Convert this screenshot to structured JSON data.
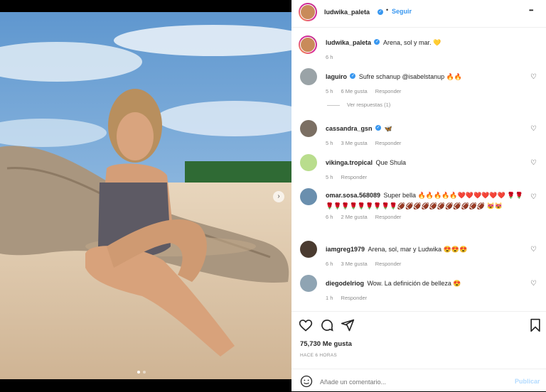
{
  "header": {
    "username": "ludwika_paleta",
    "follow_label": "Seguir",
    "more_label": "•••"
  },
  "caption": {
    "username": "ludwika_paleta",
    "text": "Arena, sol y mar. 💛",
    "time": "6 h"
  },
  "comments": [
    {
      "user": "laguiro",
      "verified": true,
      "text": "Sufre schanup @isabelstanup 🔥🔥",
      "time": "5 h",
      "likes": "6 Me gusta",
      "reply": "Responder",
      "view_replies": "Ver respuestas (1)"
    },
    {
      "user": "cassandra_gsn",
      "verified": true,
      "text": "🦋",
      "time": "5 h",
      "likes": "3 Me gusta",
      "reply": "Responder"
    },
    {
      "user": "vikinga.tropical",
      "verified": false,
      "text": "Que Shula",
      "time": "5 h",
      "likes": "",
      "reply": "Responder"
    },
    {
      "user": "omar.sosa.568089",
      "verified": false,
      "text": "Super bella 🔥🔥🔥🔥🔥❤️❤️❤️❤️❤️❤️ 🌹🌹🌹🌹🌹🌹🌹🌹🌹🌹🌹🏈🏈🏈🏈🏈🏈🏈🏈🏈🏈🏈 😻😻",
      "time": "6 h",
      "likes": "2 Me gusta",
      "reply": "Responder"
    },
    {
      "user": "iamgreg1979",
      "verified": false,
      "text": "Arena, sol, mar y Ludwika 😍😍😍",
      "time": "6 h",
      "likes": "3 Me gusta",
      "reply": "Responder"
    },
    {
      "user": "diegodelriog",
      "verified": false,
      "text": "Wow. La definición de belleza 😍",
      "time": "1 h",
      "likes": "",
      "reply": "Responder"
    }
  ],
  "post": {
    "likes": "75,730 Me gusta",
    "timestamp": "HACE 6 HORAS"
  },
  "add_comment": {
    "placeholder": "Añade un comentario...",
    "publish_label": "Publicar"
  },
  "colors": {
    "accent": "#3897f0",
    "text": "#262626",
    "muted": "#8e8e8e",
    "publish": "#b3dbff"
  }
}
